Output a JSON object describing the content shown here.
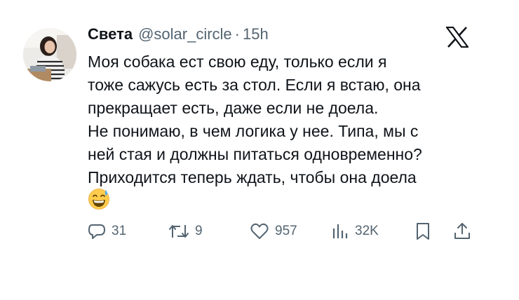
{
  "tweet": {
    "author_name": "Света",
    "handle": "@solar_circle",
    "separator": "·",
    "time": "15h",
    "lines": [
      "Моя собака ест свою еду, только если я",
      "тоже сажусь есть за стол. Если я встаю, она",
      "прекращает есть, даже если не доела.",
      "Не понимаю, в чем логика у нее. Типа, мы с",
      "ней стая и должны питаться одновременно?",
      "Приходится теперь ждать, чтобы она доела"
    ],
    "emoji": "grinning-face-with-sweat"
  },
  "actions": {
    "replies": "31",
    "reposts": "9",
    "likes": "957",
    "views": "32K"
  },
  "icons": {
    "logo": "x-logo",
    "reply": "reply-icon",
    "repost": "repost-icon",
    "like": "heart-icon",
    "views": "views-icon",
    "bookmark": "bookmark-icon",
    "share": "share-icon"
  },
  "colors": {
    "text": "#0f1419",
    "secondary": "#536471",
    "background": "#ffffff"
  }
}
